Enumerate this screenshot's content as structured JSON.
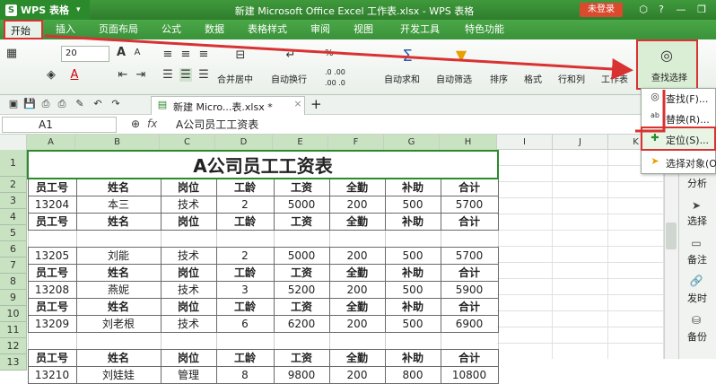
{
  "titlebar": {
    "app_name": "WPS 表格",
    "logo_letter": "S",
    "doc_title": "新建 Microsoft Office Excel 工作表.xlsx - WPS 表格",
    "login_label": "未登录"
  },
  "tabs": [
    "开始",
    "插入",
    "页面布局",
    "公式",
    "数据",
    "表格样式",
    "审阅",
    "视图",
    "开发工具",
    "特色功能"
  ],
  "ribbon": {
    "font_size": "20",
    "merge_center": "合并居中",
    "wrap_text": "自动换行",
    "auto_sum": "自动求和",
    "auto_filter": "自动筛选",
    "sort": "排序",
    "format": "格式",
    "rows_cols": "行和列",
    "sheet": "工作表",
    "find_select": "查找选择",
    "percent": "%",
    "decimal1": ".0 .00",
    "decimal2": ".00 .0"
  },
  "doc_tab": {
    "label": "新建 Micro...表.xlsx *",
    "add": "+"
  },
  "formula_bar": {
    "cell_ref": "A1",
    "fx": "fx",
    "content": "A公司员工工资表"
  },
  "columns": [
    "A",
    "B",
    "C",
    "D",
    "E",
    "F",
    "G",
    "H",
    "I",
    "J",
    "K"
  ],
  "rows": [
    "1",
    "2",
    "3",
    "4",
    "5",
    "6",
    "7",
    "8",
    "9",
    "10",
    "11",
    "12",
    "13"
  ],
  "sheet": {
    "title": "A公司员工工资表",
    "header": [
      "员工号",
      "姓名",
      "岗位",
      "工龄",
      "工资",
      "全勤",
      "补助",
      "合计"
    ],
    "records": [
      [
        "13204",
        "本三",
        "技术",
        "2",
        "5000",
        "200",
        "500",
        "5700"
      ],
      [
        "13205",
        "刘能",
        "技术",
        "2",
        "5000",
        "200",
        "500",
        "5700"
      ],
      [
        "13208",
        "燕妮",
        "技术",
        "3",
        "5200",
        "200",
        "500",
        "5900"
      ],
      [
        "13209",
        "刘老根",
        "技术",
        "6",
        "6200",
        "200",
        "500",
        "6900"
      ],
      [
        "13210",
        "刘娃娃",
        "管理",
        "8",
        "9800",
        "200",
        "800",
        "10800"
      ]
    ]
  },
  "menu": {
    "find": "查找(F)...",
    "replace": "替换(R)...",
    "locate": "定位(S)...",
    "select_objects": "选择对象(O)"
  },
  "side_panel": {
    "analyze": "分析",
    "select": "选择",
    "note": "备注",
    "publish": "发时",
    "backup": "备份"
  }
}
